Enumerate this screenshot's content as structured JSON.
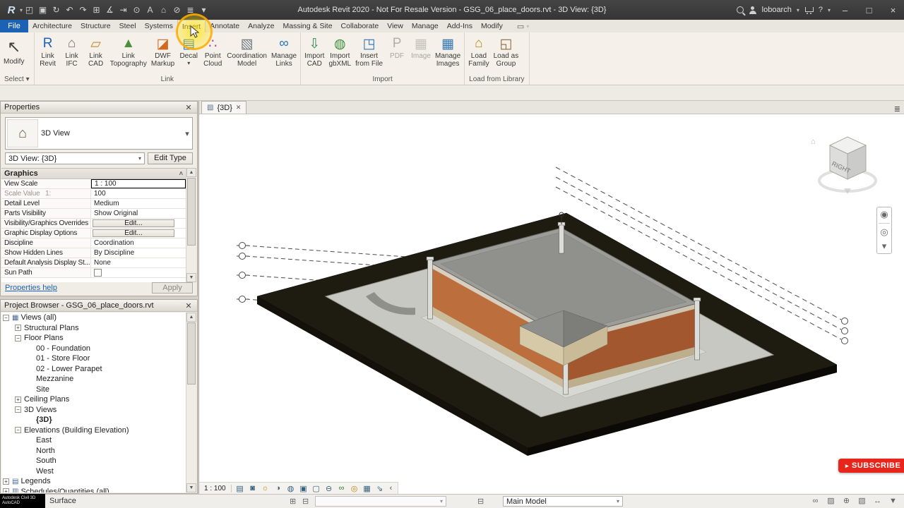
{
  "colors": {
    "accent_blue": "#1b62b5",
    "file_tab_blue": "#1b62b5",
    "subscribe_red": "#e8251b",
    "highlight_yellow": "#ffd800"
  },
  "title_bar": {
    "title": "Autodesk Revit 2020 - Not For Resale Version - GSG_06_place_doors.rvt - 3D View: {3D}",
    "user": "loboarch",
    "help_label": "?",
    "qat": [
      {
        "icon": "open-icon"
      },
      {
        "icon": "save-icon"
      },
      {
        "icon": "sync-icon"
      },
      {
        "icon": "undo-icon"
      },
      {
        "icon": "redo-icon"
      },
      {
        "icon": "print-icon"
      },
      {
        "icon": "measure-icon"
      },
      {
        "icon": "aligned-dimension-icon"
      },
      {
        "icon": "tag-icon"
      },
      {
        "icon": "text-icon"
      },
      {
        "icon": "home-icon"
      },
      {
        "icon": "section-icon"
      },
      {
        "icon": "thin-lines-icon"
      },
      {
        "icon": "qat-customize-icon"
      }
    ]
  },
  "ribbon": {
    "file_tab": "File",
    "tabs": [
      {
        "label": "Architecture"
      },
      {
        "label": "Structure"
      },
      {
        "label": "Steel"
      },
      {
        "label": "Systems"
      },
      {
        "label": "Insert",
        "cls": "active"
      },
      {
        "label": "Annotate"
      },
      {
        "label": "Analyze"
      },
      {
        "label": "Massing & Site"
      },
      {
        "label": "Collaborate"
      },
      {
        "label": "View"
      },
      {
        "label": "Manage"
      },
      {
        "label": "Add-Ins"
      },
      {
        "label": "Modify"
      }
    ],
    "select_panel": {
      "label": "Select",
      "buttons": [
        {
          "label": "Modify",
          "icon": "modify-arrow-icon"
        }
      ]
    },
    "panels": [
      {
        "label": "Link",
        "buttons": [
          {
            "label": "Link\nRevit",
            "icon": "link-revit-icon"
          },
          {
            "label": "Link\nIFC",
            "icon": "link-ifc-icon"
          },
          {
            "label": "Link\nCAD",
            "icon": "link-cad-icon"
          },
          {
            "label": "Link\nTopography",
            "icon": "link-topography-icon"
          },
          {
            "label": "DWF\nMarkup",
            "icon": "dwf-markup-icon"
          },
          {
            "label": "Decal",
            "icon": "decal-icon",
            "arrow": true
          },
          {
            "label": "Point\nCloud",
            "icon": "point-cloud-icon"
          },
          {
            "label": "Coordination\nModel",
            "icon": "coordination-model-icon"
          },
          {
            "label": "Manage\nLinks",
            "icon": "manage-links-icon"
          }
        ]
      },
      {
        "label": "Import",
        "buttons": [
          {
            "label": "Import\nCAD",
            "icon": "import-cad-icon"
          },
          {
            "label": "Import\ngbXML",
            "icon": "import-gbxml-icon"
          },
          {
            "label": "Insert\nfrom File",
            "icon": "insert-from-file-icon"
          },
          {
            "label": "PDF",
            "icon": "pdf-icon",
            "disabled": true
          },
          {
            "label": "Image",
            "icon": "image-icon",
            "disabled": true
          },
          {
            "label": "Manage\nImages",
            "icon": "manage-images-icon"
          }
        ]
      },
      {
        "label": "Load from Library",
        "buttons": [
          {
            "label": "Load\nFamily",
            "icon": "load-family-icon"
          },
          {
            "label": "Load as\nGroup",
            "icon": "load-as-group-icon"
          }
        ]
      }
    ]
  },
  "properties": {
    "title": "Properties",
    "type_label": "3D View",
    "selector_value": "3D View: {3D}",
    "edit_type_label": "Edit Type",
    "section_label": "Graphics",
    "rows": [
      {
        "label": "View Scale",
        "value": "1 : 100",
        "cls": "sel"
      },
      {
        "label": "Scale Value   1:",
        "value": "100",
        "cls": "dim"
      },
      {
        "label": "Detail Level",
        "value": "Medium"
      },
      {
        "label": "Parts Visibility",
        "value": "Show Original"
      },
      {
        "label": "Visibility/Graphics Overrides",
        "value": "Edit...",
        "cls": "kind-edit"
      },
      {
        "label": "Graphic Display Options",
        "value": "Edit...",
        "cls": "kind-edit"
      },
      {
        "label": "Discipline",
        "value": "Coordination"
      },
      {
        "label": "Show Hidden Lines",
        "value": "By Discipline"
      },
      {
        "label": "Default Analysis Display St...",
        "value": "None"
      },
      {
        "label": "Sun Path",
        "value": "",
        "cls": "kind-checkbox"
      }
    ],
    "help_link": "Properties help",
    "apply_label": "Apply"
  },
  "project_browser": {
    "title": "Project Browser - GSG_06_place_doors.rvt",
    "items": [
      {
        "label": "Views (all)",
        "level": 0,
        "icon": "views-icon",
        "expand": "minus"
      },
      {
        "label": "Structural Plans",
        "level": 1,
        "expand": "plus"
      },
      {
        "label": "Floor Plans",
        "level": 1,
        "expand": "minus"
      },
      {
        "label": "00 - Foundation",
        "level": 2
      },
      {
        "label": "01 - Store Floor",
        "level": 2
      },
      {
        "label": "02 - Lower Parapet",
        "level": 2
      },
      {
        "label": "Mezzanine",
        "level": 2
      },
      {
        "label": "Site",
        "level": 2
      },
      {
        "label": "Ceiling Plans",
        "level": 1,
        "expand": "plus"
      },
      {
        "label": "3D Views",
        "level": 1,
        "expand": "minus"
      },
      {
        "label": "{3D}",
        "level": 2,
        "bold": true
      },
      {
        "label": "Elevations (Building Elevation)",
        "level": 1,
        "expand": "minus"
      },
      {
        "label": "East",
        "level": 2
      },
      {
        "label": "North",
        "level": 2
      },
      {
        "label": "South",
        "level": 2
      },
      {
        "label": "West",
        "level": 2
      },
      {
        "label": "Legends",
        "level": 0,
        "icon": "legends-icon",
        "expand": "plus"
      },
      {
        "label": "Schedules/Quantities (all)",
        "level": 0,
        "icon": "schedules-icon",
        "expand": "plus"
      }
    ]
  },
  "viewport": {
    "tab_label": "{3D}",
    "scale": "1 : 100",
    "view_cube_label": "RIGHT",
    "subscribe_label": "SUBSCRIBE",
    "vcb_icons": [
      {
        "icon": "detail-level-icon"
      },
      {
        "icon": "visual-style-icon"
      },
      {
        "icon": "sun-path-icon"
      },
      {
        "icon": "shadows-icon"
      },
      {
        "icon": "rendering-icon"
      },
      {
        "icon": "crop-view-icon"
      },
      {
        "icon": "show-crop-icon"
      },
      {
        "icon": "lock-view-icon"
      },
      {
        "icon": "hide-isolate-icon"
      },
      {
        "icon": "reveal-hidden-icon"
      },
      {
        "icon": "temp-view-properties-icon"
      },
      {
        "icon": "displace-elements-icon"
      }
    ]
  },
  "status_bar": {
    "watermark_line1": "Autodesk Civil 3D",
    "watermark_line2": "AutoCAD",
    "hint": "Surface",
    "workset_value": "",
    "design_option": "Main Model",
    "right_icons": [
      {
        "icon": "select-links-icon"
      },
      {
        "icon": "select-underlay-icon"
      },
      {
        "icon": "select-pinned-icon"
      },
      {
        "icon": "select-faces-icon"
      },
      {
        "icon": "drag-on-selection-icon"
      },
      {
        "icon": "filter-icon"
      }
    ]
  }
}
